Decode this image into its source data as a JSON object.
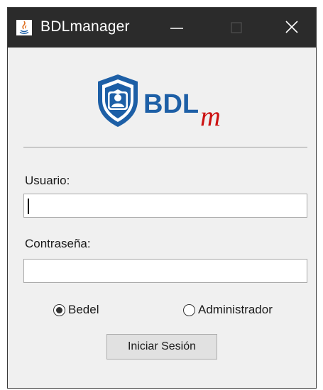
{
  "window": {
    "title": "BDLmanager",
    "titlebar_color": "#2b2b2b",
    "icons": {
      "app": "java-icon",
      "minimize": "minimize-icon",
      "maximize": "maximize-icon",
      "close": "close-icon"
    }
  },
  "logo": {
    "text": "BDL",
    "subscript": "m",
    "text_color": "#1d5fa6",
    "subscript_color": "#cc1111",
    "icon": "shield-user-icon"
  },
  "form": {
    "user_label": "Usuario:",
    "user_value": "",
    "password_label": "Contraseña:",
    "password_value": "",
    "roles": [
      {
        "label": "Bedel",
        "selected": true
      },
      {
        "label": "Administrador",
        "selected": false
      }
    ],
    "login_button": "Iniciar Sesión"
  }
}
